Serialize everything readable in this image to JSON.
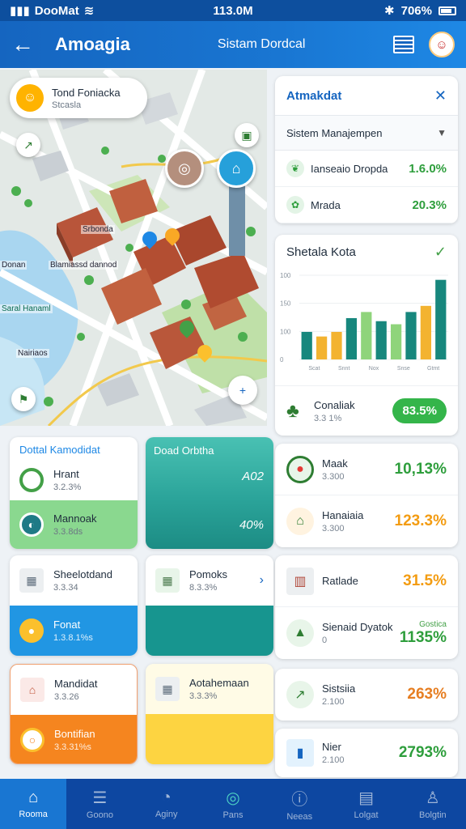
{
  "status": {
    "carrier": "DooMat",
    "time": "113.0M",
    "battery": "706%"
  },
  "app": {
    "title": "Amoagia",
    "subtitle": "Sistam Dordcal"
  },
  "map": {
    "profile": {
      "name": "Tond Foniacka",
      "sub": "Stcasla"
    },
    "labels": [
      "Srbonda",
      "Donan",
      "Blamiassd dannod",
      "Saral Hanaml",
      "Nairiaos"
    ]
  },
  "alert_card": {
    "title": "Atmakdat",
    "dropdown": "Sistem Manajempen",
    "rows": [
      {
        "label": "Ianseaio Dropda",
        "value": "1.6.0%"
      },
      {
        "label": "Mrada",
        "value": "20.3%"
      }
    ]
  },
  "chart_card": {
    "title": "Shetala Kota",
    "footer": {
      "name": "Conaliak",
      "sub": "3.3 1%",
      "value": "83.5%"
    }
  },
  "chart_data": {
    "type": "bar",
    "yticks": [
      "100",
      "150",
      "100",
      "0"
    ],
    "xlabels": [
      "Scat",
      "Snnt",
      "Nox",
      "Snse",
      "Gtmt"
    ],
    "values": [
      18,
      15,
      18,
      27,
      31,
      25,
      23,
      31,
      35,
      52
    ],
    "colors": [
      "#17877d",
      "#f3b330",
      "#f3b330",
      "#17877d",
      "#8fd47b",
      "#17877d",
      "#8fd47b",
      "#17877d",
      "#f3b330",
      "#17877d"
    ]
  },
  "right_list_1": [
    {
      "name": "Maak",
      "sub": "3.300",
      "value": "10,13%",
      "color": "#2e9e3c"
    },
    {
      "name": "Hanaiaia",
      "sub": "3.300",
      "value": "123.3%",
      "color": "#f39c12"
    }
  ],
  "right_list_2": [
    {
      "name": "Ratlade",
      "sub": "",
      "value": "31.5%",
      "color": "#f39c12"
    },
    {
      "name": "Sienaid Dyatok",
      "sub": "0",
      "value": "1135%",
      "tiny": "Gostica",
      "color": "#2e9e3c"
    }
  ],
  "right_list_3": [
    {
      "name": "Sistsiia",
      "sub": "2.100",
      "value": "263%",
      "color": "#e67e22"
    }
  ],
  "right_list_4": [
    {
      "name": "Nier",
      "sub": "2.100",
      "value": "2793%",
      "color": "#2e9e3c"
    }
  ],
  "left_cards": {
    "c1": {
      "title": "Dottal Kamodidat",
      "a_name": "Hrant",
      "a_sub": "3.2.3%",
      "b_name": "Mannoak",
      "b_sub": "3.3.8ds"
    },
    "c2": {
      "title": "Doad Orbtha",
      "v1": "A02",
      "v2": "40%"
    },
    "c3": {
      "a_name": "Sheelotdand",
      "a_sub": "3.3.34",
      "b_name": "Fonat",
      "b_sub": "1.3.8.1%s"
    },
    "c4": {
      "a_name": "Pomoks",
      "a_sub": "8.3.3%"
    },
    "c5": {
      "a_name": "Mandidat",
      "a_sub": "3.3.26",
      "b_name": "Bontifian",
      "b_sub": "3.3.31%s"
    },
    "c6": {
      "a_name": "Aotahemaan",
      "a_sub": "3.3.3%"
    }
  },
  "nav": [
    "Rooma",
    "Goono",
    "Aginy",
    "Pans",
    "Neeas",
    "Lolgat",
    "Bolgtin"
  ]
}
